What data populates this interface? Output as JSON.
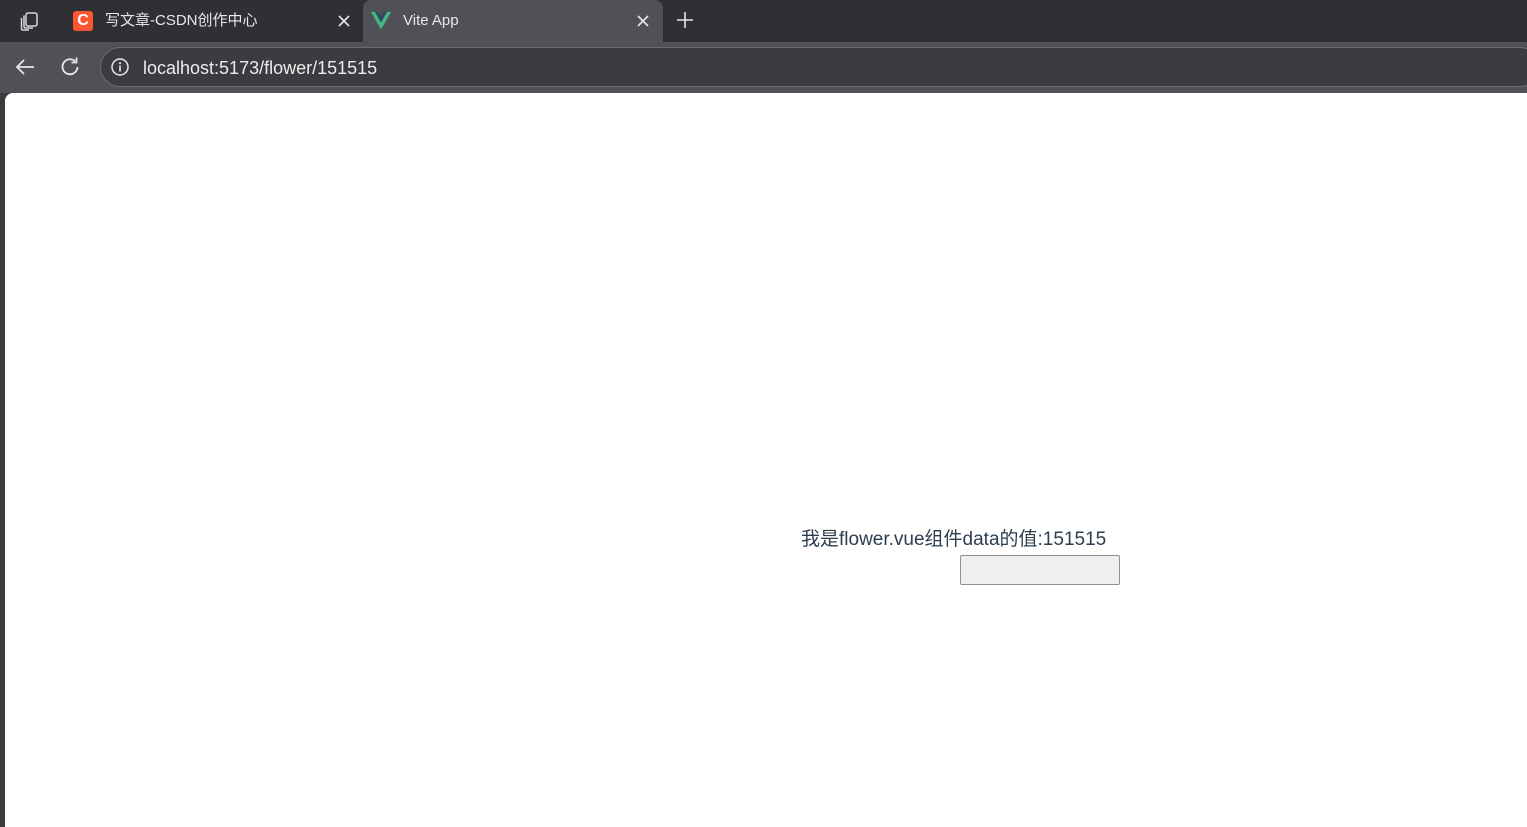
{
  "browser": {
    "tabs": [
      {
        "title": "写文章-CSDN创作中心",
        "favicon": "csdn-c-icon",
        "favicon_letter": "C",
        "active": false
      },
      {
        "title": "Vite App",
        "favicon": "vue-logo-icon",
        "active": true
      }
    ],
    "url": "localhost:5173/flower/151515",
    "icons": {
      "workspaces": "workspaces-icon",
      "close": "close-icon",
      "new_tab": "plus-icon",
      "back": "arrow-left-icon",
      "reload": "reload-icon",
      "site_info": "info-icon"
    }
  },
  "page": {
    "flower_text": "我是flower.vue组件data的值:151515",
    "input_value": ""
  },
  "colors": {
    "tab_strip": "#2f3034",
    "active_tab": "#505156",
    "csdn_brand": "#fc5531",
    "vue_green": "#42b883",
    "vue_dark": "#35495e",
    "page_background": "#ffffff",
    "page_text": "#2c3e50"
  }
}
